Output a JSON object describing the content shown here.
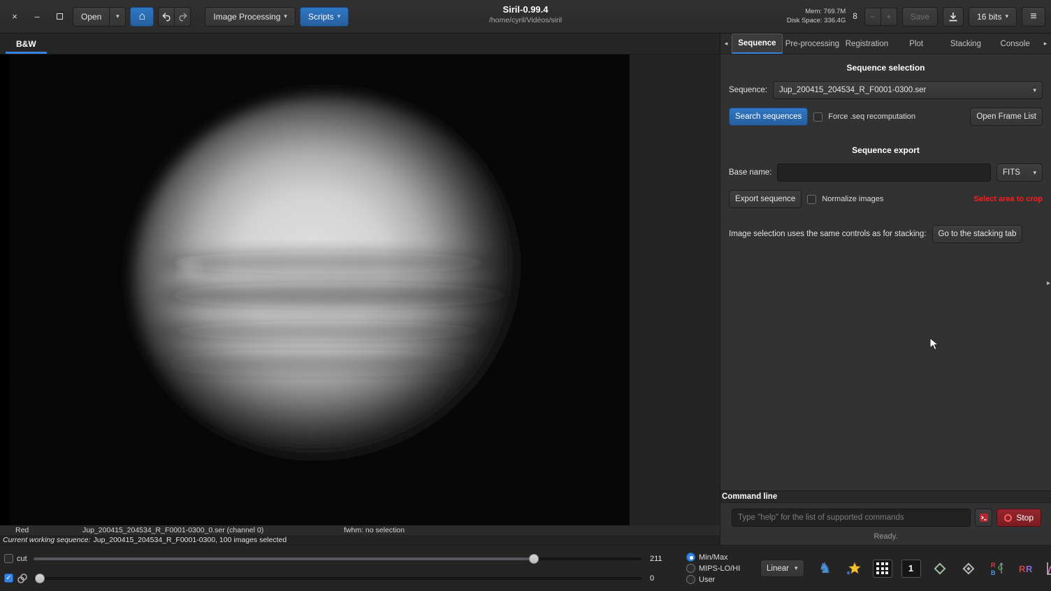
{
  "colors": {
    "accent_blue": "#3584e4",
    "button_blue": "#2a6db8",
    "warning_red": "#ff1a1a",
    "stop_red": "#8a2028"
  },
  "glyphs": {
    "close": "×",
    "minimize": "–",
    "dropdown": "▾",
    "home": "⌂",
    "menu": "≡",
    "minus": "−",
    "plus": "+",
    "check": "✓",
    "arrow_left": "◂",
    "arrow_right": "▸",
    "knight": "♞"
  },
  "titlebar": {
    "open_label": "Open",
    "image_processing_label": "Image Processing",
    "scripts_label": "Scripts",
    "title": "Siril-0.99.4",
    "subtitle": "/home/cyril/Vidéos/siril",
    "mem": "Mem: 769.7M",
    "disk": "Disk Space: 336.4G",
    "frame_value": "8",
    "save_label": "Save",
    "bits_label": "16 bits"
  },
  "viewer": {
    "tab_label": "B&W",
    "channel": "Red",
    "filename": "Jup_200415_204534_R_F0001-0300_0.ser (channel 0)",
    "fwhm": "fwhm: no selection",
    "sequence_prefix": "Current working sequence:",
    "sequence_info": "Jup_200415_204534_R_F0001-0300, 100 images selected"
  },
  "display": {
    "cut_label": "cut",
    "high_value": "211",
    "low_value": "0",
    "radio_minmax": "Min/Max",
    "radio_mips": "MIPS-LO/HI",
    "radio_user": "User",
    "scale_mode": "Linear",
    "single_frame_label": "1"
  },
  "panel": {
    "tabs": [
      "Sequence",
      "Pre-processing",
      "Registration",
      "Plot",
      "Stacking",
      "Console"
    ],
    "active_tab": "Sequence",
    "selection": {
      "heading": "Sequence selection",
      "sequence_label": "Sequence:",
      "sequence_value": "Jup_200415_204534_R_F0001-0300.ser",
      "search_button": "Search sequences",
      "force_label": "Force .seq recomputation",
      "open_frame_list": "Open Frame List"
    },
    "export": {
      "heading": "Sequence export",
      "base_name_label": "Base name:",
      "base_name_value": "",
      "format": "FITS",
      "export_button": "Export sequence",
      "normalize_label": "Normalize images",
      "crop_warning": "Select area to crop"
    },
    "stacking_note": "Image selection uses the same controls as for stacking:",
    "stacking_button": "Go to the stacking tab",
    "command": {
      "heading": "Command line",
      "placeholder": "Type \"help\" for the list of supported commands",
      "stop_label": "Stop",
      "status": "Ready."
    }
  }
}
